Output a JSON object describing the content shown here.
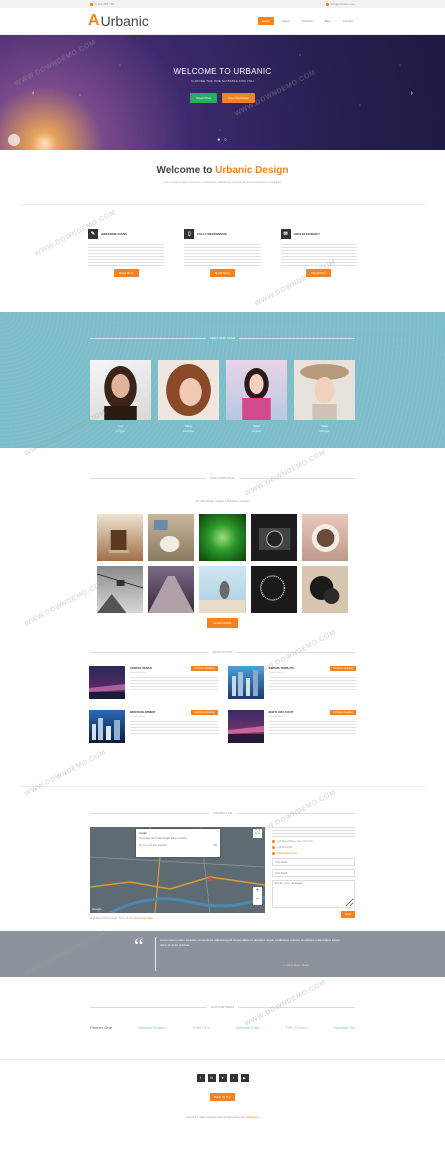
{
  "topbar": {
    "phone": "0 123 456 789",
    "email": "info@urbanic.com"
  },
  "nav": {
    "logo_mark": "A",
    "logo_text": "Urbanic",
    "items": [
      "Home",
      "About",
      "Portfolio",
      "Blog",
      "Contact"
    ]
  },
  "hero": {
    "title": "WELCOME TO URBANIC",
    "subtitle": "CHOOSE THE ONE SUITABLE FOR YOU",
    "btn1": "Read More",
    "btn2": "Free Download",
    "prev_arrow": "‹",
    "next_arrow": "›",
    "dots": "● ○"
  },
  "welcome": {
    "title_plain": "Welcome to ",
    "title_accent": "Urbanic Design",
    "text": "Lorem ipsum dolor sit amet consectetur adipiscing elit sed do eiusmod tempor incididunt"
  },
  "features": [
    {
      "icon": "✎",
      "icon_name": "pencil-icon",
      "title": "AWESOME ICONS",
      "button": "Read More"
    },
    {
      "icon": "▯",
      "icon_name": "mobile-icon",
      "title": "FULLY RESPONSIVE",
      "button": "Read More"
    },
    {
      "icon": "✉",
      "icon_name": "envelope-icon",
      "title": "HIGH EFFICIENCY",
      "button": "Read More"
    }
  ],
  "team": {
    "title": "MEET OUR TEAM",
    "members": [
      {
        "name": "Ann",
        "role": "Designer"
      },
      {
        "name": "Mary",
        "role": "Developer"
      },
      {
        "name": "Sara",
        "role": "Marketer"
      },
      {
        "name": "Kate",
        "role": "Manager"
      }
    ]
  },
  "portfolio": {
    "title": "OUR PORTFOLIO",
    "filters": "All | Web Design | Graphic | Illustration | Creative",
    "load_more": "LOAD MORE"
  },
  "blog": {
    "title": "BLOG POSTS",
    "posts": [
      {
        "title": "GRAPHIC DESIGN",
        "tag": "Continue Reading",
        "meta": "Posted by Admin"
      },
      {
        "title": "WEBSITE TEMPLATE",
        "tag": "Continue Reading",
        "meta": "Posted by Admin"
      },
      {
        "title": "WEB DEVELOPMENT",
        "tag": "Continue Reading",
        "meta": "Posted by Admin"
      },
      {
        "title": "NEW FLOID LAYOUT",
        "tag": "Continue Reading",
        "meta": "Posted by Admin"
      }
    ]
  },
  "contact": {
    "title": "CONTACT US",
    "map_info_title": "Google",
    "map_info_text": "This page can't load Google Maps correctly.",
    "map_info_dismiss": "Do you own this website?",
    "map_info_ok": "OK",
    "fullscreen_icon": "⛶",
    "zoom_in": "+",
    "zoom_out": "−",
    "google_label": "Google",
    "map_caption": "Map data ©2016 Google, Terms of Use",
    "map_link": "View Larger Map",
    "address": "123 Street Name, New York City",
    "phone": "+00 000 0000",
    "email": "info@urbanic.com",
    "name_placeholder": "Your Name",
    "email_placeholder": "Your Email",
    "message_placeholder": "Write your message...",
    "send": "Send"
  },
  "quote": {
    "mark": "“",
    "text": "Lorem ipsum dolor sit amet, consectetur adipiscing elit suspendisse in pharetra neque vestibulum pretium at ultricies nulla finibus ipsum dolor sit amet pulvinar.",
    "author": "— Jane Doe, Client"
  },
  "partners": {
    "title": "OUR PARTNERS",
    "items": [
      {
        "name": "Partner One",
        "color": "#666666"
      },
      {
        "name": "Second Partner",
        "color": "#7fc4cf"
      },
      {
        "name": "Third One",
        "color": "#bbbbbb"
      },
      {
        "name": "Number Four",
        "color": "#7fc4cf"
      },
      {
        "name": "Fifth Partner",
        "color": "#bbbbbb"
      },
      {
        "name": "Number Six",
        "color": "#7fc4cf"
      }
    ]
  },
  "footer": {
    "social": [
      "f",
      "in",
      "♥",
      "t",
      "▶"
    ],
    "back_to_top": "Back To Top",
    "copyright": "Copyright © 2016 Company name All rights Reserved | ",
    "credit": "W3Layouts"
  },
  "watermark": "WWW.DOWNDEMO.COM",
  "colors": {
    "accent": "#f58220",
    "team_bg": "#7cbdc9",
    "quote_bg": "#8b949c",
    "green": "#27ae60"
  }
}
